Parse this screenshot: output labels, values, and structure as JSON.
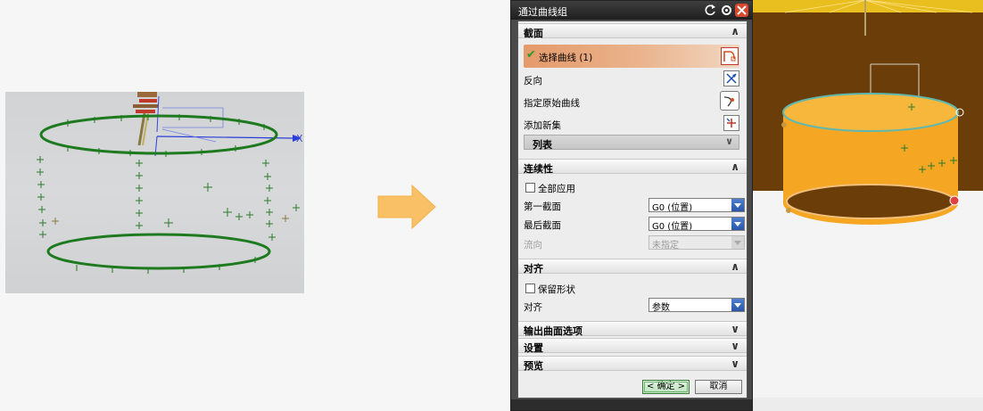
{
  "dialog": {
    "title": "通过曲线组",
    "sections": {
      "section": {
        "header": "截面",
        "select_curve": "选择曲线 (1)",
        "reverse": "反向",
        "specify_origin_curve": "指定原始曲线",
        "add_new_set": "添加新集",
        "list": "列表"
      },
      "continuity": {
        "header": "连续性",
        "apply_all": "全部应用",
        "first_section_label": "第一截面",
        "first_section_value": "G0 (位置)",
        "last_section_label": "最后截面",
        "last_section_value": "G0 (位置)",
        "flow_label": "流向",
        "flow_value": "未指定"
      },
      "alignment": {
        "header": "对齐",
        "keep_shape": "保留形状",
        "align_label": "对齐",
        "align_value": "参数"
      },
      "output_surface_options": {
        "header": "输出曲面选项"
      },
      "settings": {
        "header": "设置"
      },
      "preview": {
        "header": "预览"
      }
    },
    "ok_label": "< 确定 >",
    "cancel_label": "取消"
  },
  "left_view": {
    "axis_label": "X"
  },
  "colors": {
    "curve_green": "#1e7a1e",
    "surface_orange": "#f5a623",
    "interior_brown": "#6b3d08",
    "selection_orange": "#e59a6a",
    "arrow_orange": "#f9c066"
  }
}
